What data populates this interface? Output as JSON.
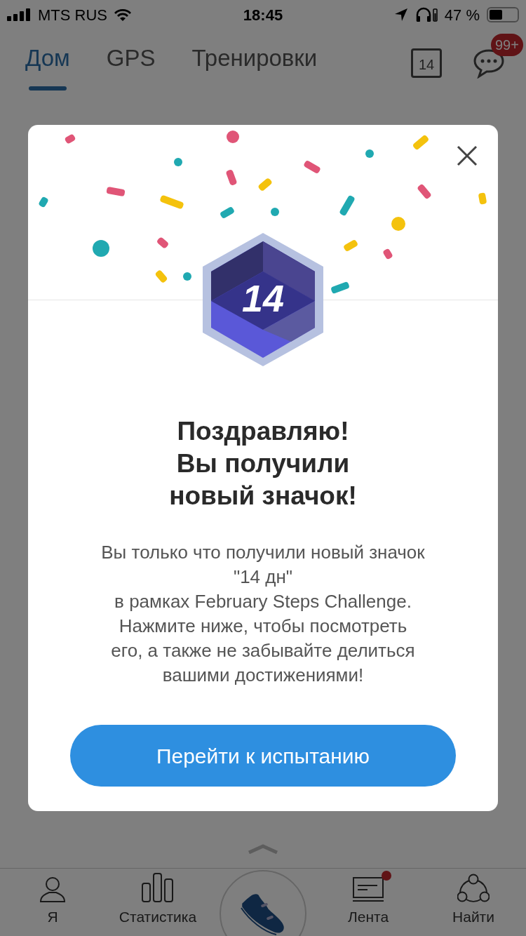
{
  "status_bar": {
    "carrier": "MTS RUS",
    "time": "18:45",
    "battery": "47 %"
  },
  "tabs": [
    {
      "label": "Дом",
      "selected": true
    },
    {
      "label": "GPS",
      "selected": false
    },
    {
      "label": "Тренировки",
      "selected": false
    }
  ],
  "calendar_day": "14",
  "messages_badge": "99+",
  "dialog": {
    "badge_number": "14",
    "title_lines": [
      "Поздравляю!",
      "Вы получили",
      "новый значок!"
    ],
    "message_lines": [
      "Вы только что получили новый значок",
      "\"14 дн\"",
      "в рамках February Steps Challenge.",
      "Нажмите ниже, чтобы посмотреть",
      "его, а также не забывайте делиться",
      "вашими достижениями!"
    ],
    "button": "Перейти к испытанию"
  },
  "bottom_nav": [
    {
      "kind": "person",
      "label": "Я",
      "notification": false
    },
    {
      "kind": "stats",
      "label": "Статистика",
      "notification": false
    },
    {
      "kind": "shoe",
      "notification": false
    },
    {
      "kind": "feed",
      "label": "Лента",
      "notification": true
    },
    {
      "kind": "find",
      "label": "Найти",
      "notification": false
    }
  ]
}
